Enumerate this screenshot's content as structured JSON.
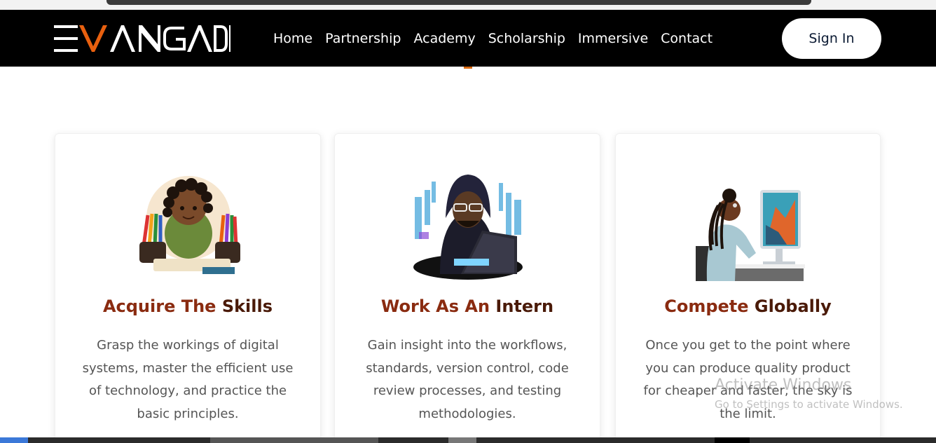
{
  "logo": {
    "text": "EVANGADI",
    "accent_color": "#e8600f"
  },
  "nav": {
    "items": [
      {
        "label": "Home"
      },
      {
        "label": "Partnership"
      },
      {
        "label": "Academy"
      },
      {
        "label": "Scholarship"
      },
      {
        "label": "Immersive"
      },
      {
        "label": "Contact"
      }
    ],
    "signin_label": "Sign In"
  },
  "cards": [
    {
      "title_a": "Acquire The ",
      "title_b": "Skills",
      "body": "Grasp the workings of digital systems, master the efficient use of technology, and practice the basic principles.",
      "illustration": "girl-with-pencils-icon"
    },
    {
      "title_a": "Work As An ",
      "title_b": "Intern",
      "body": "Gain insight into the workflows, standards, version control, code review processes, and testing methodologies.",
      "illustration": "hooded-coder-laptop-icon"
    },
    {
      "title_a": "Compete ",
      "title_b": "Globally",
      "body": "Once you get to the point where you can produce quality product for cheaper and faster, the sky is the limit.",
      "illustration": "woman-at-computer-icon"
    }
  ],
  "watermark": {
    "line1": "Activate Windows",
    "line2": "Go to Settings to activate Windows."
  },
  "colors": {
    "navbar": "#000000",
    "title": "#8a2b10",
    "body_text": "#555555",
    "accent": "#e8600f"
  }
}
